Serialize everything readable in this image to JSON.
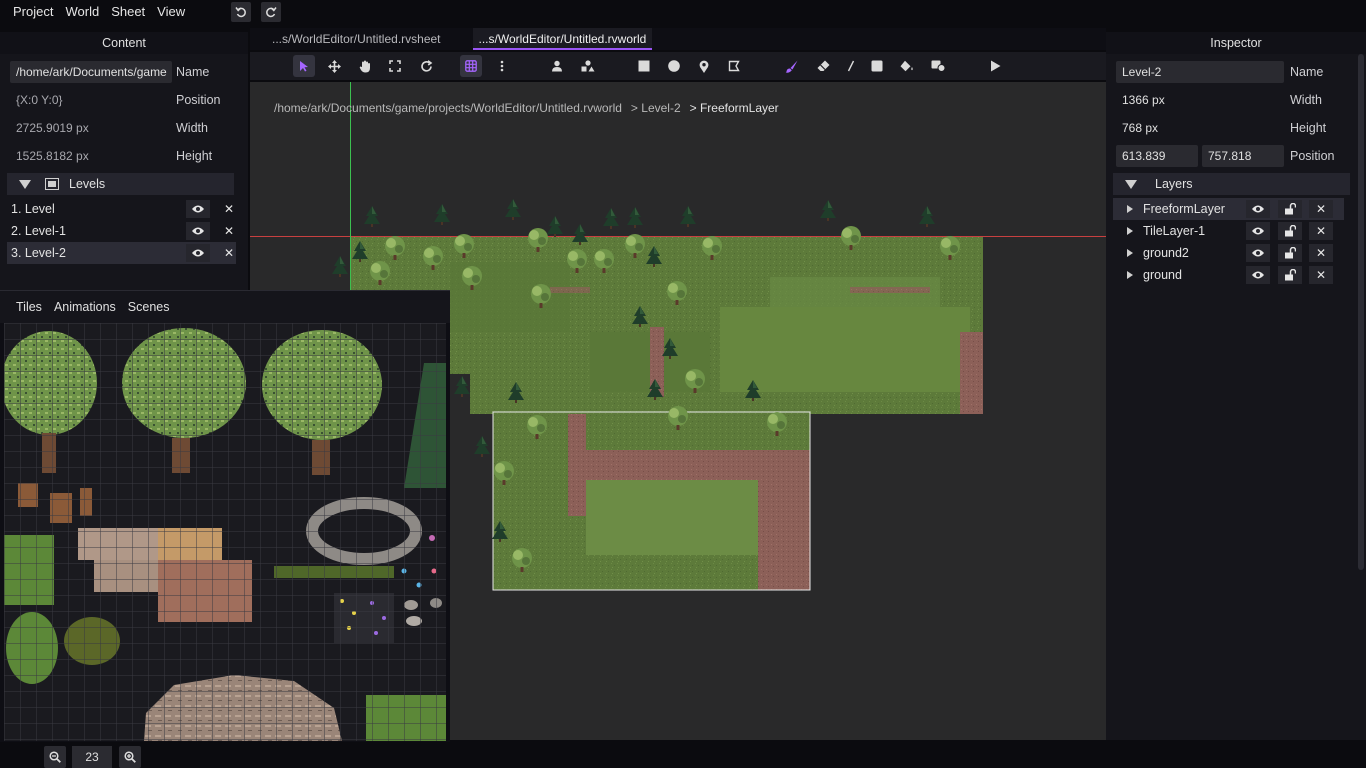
{
  "menu": {
    "items": [
      "Project",
      "World",
      "Sheet",
      "View"
    ],
    "undo_icon": "undo-icon",
    "redo_icon": "redo-icon"
  },
  "content_panel": {
    "title": "Content",
    "name_value": "/home/ark/Documents/game",
    "name_label": "Name",
    "position_value": "{X:0 Y:0}",
    "position_label": "Position",
    "width_value": "2725.9019 px",
    "width_label": "Width",
    "height_value": "1525.8182 px",
    "height_label": "Height",
    "levels_header": "Levels",
    "levels": [
      {
        "label": "1. Level",
        "selected": false
      },
      {
        "label": "2. Level-1",
        "selected": false
      },
      {
        "label": "3. Level-2",
        "selected": true
      }
    ]
  },
  "tiles_panel": {
    "tabs": [
      "Tiles",
      "Animations",
      "Scenes"
    ]
  },
  "editor": {
    "tabs": [
      {
        "label": "...s/WorldEditor/Untitled.rvsheet",
        "active": false
      },
      {
        "label": "...s/WorldEditor/Untitled.rvworld",
        "active": true
      }
    ],
    "breadcrumb": [
      "/home/ark/Documents/game/projects/WorldEditor/Untitled.rvworld",
      "> Level-2",
      "> FreeformLayer"
    ]
  },
  "toolbar": {
    "tools": [
      "select-arrow-icon",
      "move-icon",
      "hand-icon",
      "fit-icon",
      "refresh-icon",
      "grid-icon",
      "more-vertical-icon",
      "entity-icon",
      "shapes-icon",
      "rectangle-icon",
      "circle-icon",
      "pin-icon",
      "anchor-icon",
      "brush-icon",
      "eraser-icon",
      "line-icon",
      "fill-rect-icon",
      "bucket-icon",
      "stamp-icon",
      "play-icon"
    ],
    "active_tools": [
      "select-arrow-icon",
      "grid-icon"
    ]
  },
  "inspector": {
    "title": "Inspector",
    "name_value": "Level-2",
    "name_label": "Name",
    "width_value": "1366 px",
    "width_label": "Width",
    "height_value": "768 px",
    "height_label": "Height",
    "position_x": "613.839",
    "position_y": "757.818",
    "position_label": "Position",
    "layers_header": "Layers",
    "layers": [
      {
        "label": "FreeformLayer",
        "selected": true
      },
      {
        "label": "TileLayer-1",
        "selected": false
      },
      {
        "label": "ground2",
        "selected": false
      },
      {
        "label": "ground",
        "selected": false
      }
    ]
  },
  "zoom": {
    "value": "23"
  },
  "colors": {
    "accent": "#9a55f5",
    "grass": "#5f7a3c",
    "dirt": "#8a5d58",
    "canvas_bg": "#29292a"
  }
}
